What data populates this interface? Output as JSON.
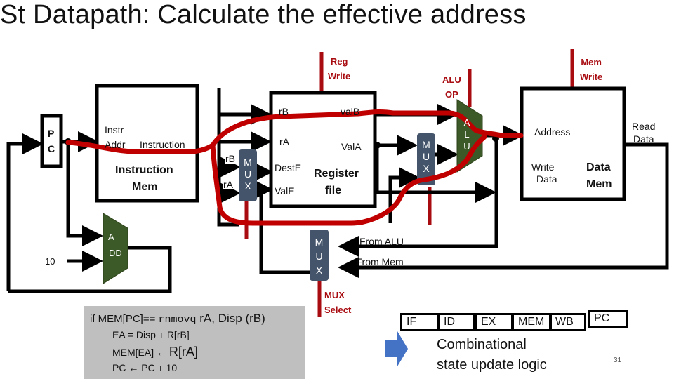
{
  "title": "St Datapath: Calculate the effective address",
  "controls": {
    "reg_write": [
      "Reg",
      "Write"
    ],
    "alu_op": [
      "ALU",
      "OP"
    ],
    "mem_write": [
      "Mem",
      "Write"
    ],
    "mux_select": [
      "MUX",
      "Select"
    ]
  },
  "pc": {
    "label_line1": "P",
    "label_line2": "C"
  },
  "instr_mem": {
    "port_in_line1": "Instr",
    "port_in_line2": "Addr",
    "port_out": "Instruction",
    "name_line1": "Instruction",
    "name_line2": "Mem"
  },
  "adder": {
    "label_line1": "A",
    "label_line2": "DD",
    "constant": "10"
  },
  "reg_mux": {
    "in_rb": "rB",
    "in_ra": "rA",
    "letters": [
      "M",
      "U",
      "X"
    ]
  },
  "register_file": {
    "port_rb": "rB",
    "port_ra": "rA",
    "port_deste": "DestE",
    "port_vale": "ValE",
    "out_valb": "valB",
    "out_vala": "ValA",
    "name_line1": "Register",
    "name_line2": "file"
  },
  "alu_mux": {
    "letters": [
      "M",
      "U",
      "X"
    ]
  },
  "alu": {
    "letters": [
      "A",
      "L",
      "U"
    ]
  },
  "data_mem": {
    "port_address": "Address",
    "port_write_line1": "Write",
    "port_write_line2": "Data",
    "out_read_line1": "Read",
    "out_read_line2": "Data",
    "name_line1": "Data",
    "name_line2": "Mem"
  },
  "wb_mux": {
    "letters": [
      "M",
      "U",
      "X"
    ],
    "in_alu": "From ALU",
    "in_mem": "From Mem"
  },
  "code": {
    "line1_prefix": "if MEM[PC]== ",
    "line1_opcode": "rnmovq",
    "line1_args": " rA, Disp (rB)",
    "line2": "EA = Disp + R[rB]",
    "line3_prefix": "MEM[EA] ← ",
    "line3_suffix": "R[rA]",
    "line4": "PC ← PC + 10"
  },
  "stages": [
    "IF",
    "ID",
    "EX",
    "MEM",
    "WB",
    "PC"
  ],
  "combinational_line1": "Combinational",
  "combinational_line2": "state update logic",
  "page_number": "31",
  "colors": {
    "highlight_path": "#c00000",
    "control_text": "#a80b10",
    "mux_fill": "#44546a",
    "alu_fill": "#3c5a28",
    "arrow_fill": "#4472c4",
    "code_bg": "#bfbfbf"
  }
}
